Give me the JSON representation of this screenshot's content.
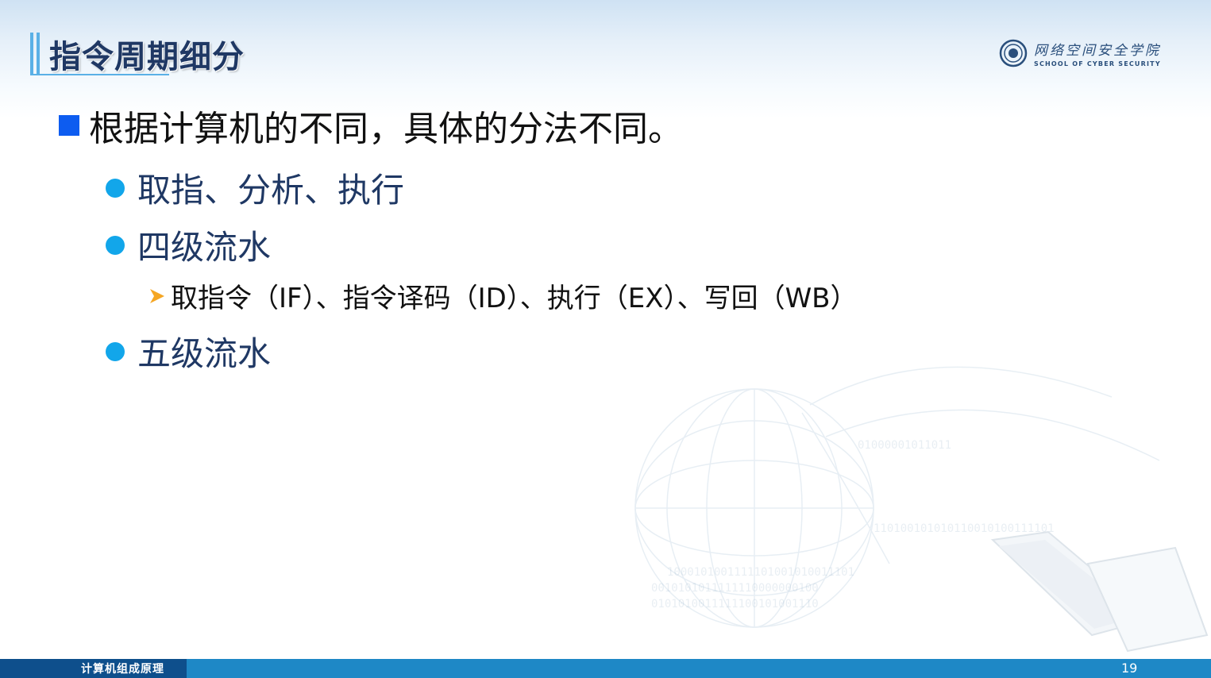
{
  "slide": {
    "title": "指令周期细分",
    "logo": {
      "cn": "网络空间安全学院",
      "en": "SCHOOL OF CYBER SECURITY"
    },
    "bullets": {
      "main": "根据计算机的不同，具体的分法不同。",
      "items": [
        {
          "label": "取指、分析、执行"
        },
        {
          "label": "四级流水",
          "sub": "取指令（IF）、指令译码（ID）、执行（EX）、写回（WB）"
        },
        {
          "label": "五级流水"
        }
      ]
    },
    "footer": {
      "course": "计算机组成原理",
      "page": "19"
    }
  },
  "colors": {
    "title": "#1f3864",
    "accent_square": "#0d5cf0",
    "accent_dot": "#12a6ea",
    "arrow": "#f5a623",
    "footer_bar": "#1e88c6",
    "footer_left": "#0e4f8c"
  },
  "icons": [
    "square-bullet-icon",
    "circle-bullet-icon",
    "arrow-bullet-icon",
    "school-seal-icon",
    "globe-decoration",
    "laptop-decoration"
  ]
}
